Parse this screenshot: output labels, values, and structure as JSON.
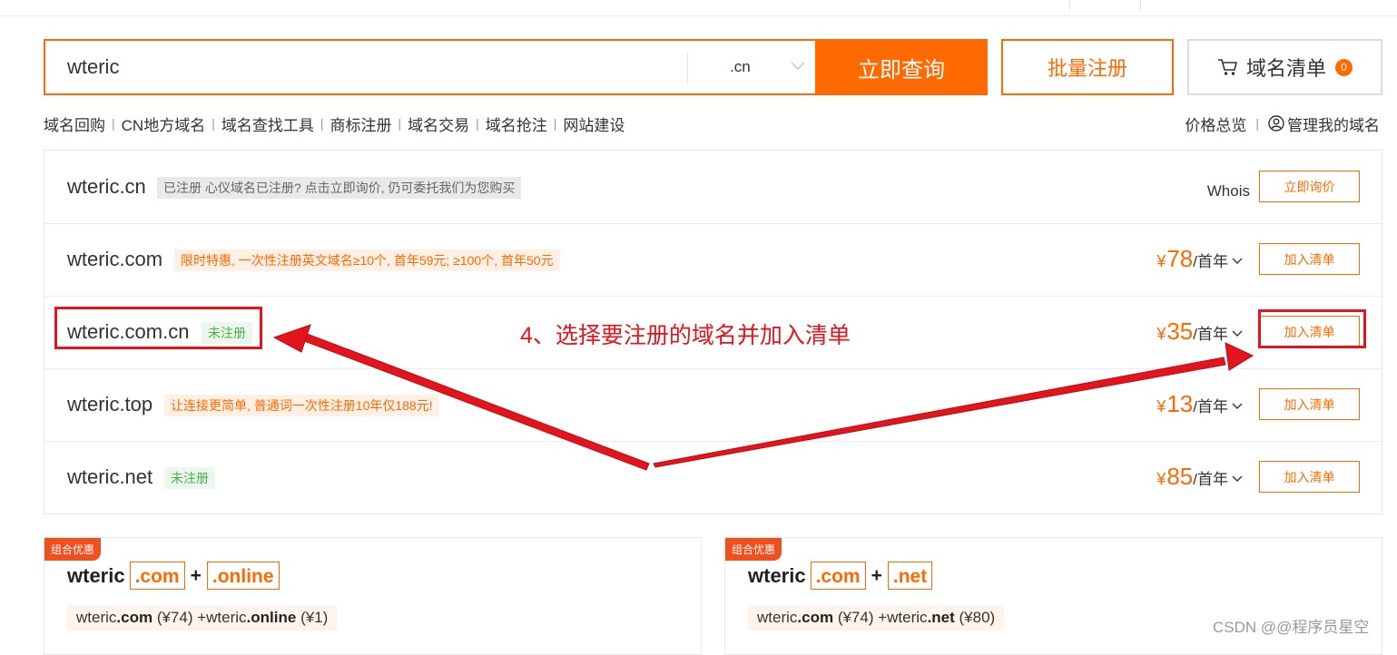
{
  "search": {
    "value": "wteric",
    "tld": ".cn",
    "submit_label": "立即查询",
    "bulk_label": "批量注册",
    "cart_label": "域名清单",
    "cart_count": "0"
  },
  "subnav": {
    "left": [
      "域名回购",
      "CN地方域名",
      "域名查找工具",
      "商标注册",
      "域名交易",
      "域名抢注",
      "网站建设"
    ],
    "separator": "|",
    "price_overview": "价格总览",
    "manage": "管理我的域名"
  },
  "results": [
    {
      "domain": "wteric.cn",
      "tag": "已注册 心仪域名已注册? 点击立即询价, 仍可委托我们为您购买",
      "tag_type": "registered",
      "whois": "Whois",
      "action": "立即询价"
    },
    {
      "domain": "wteric.com",
      "tag": "限时特惠, 一次性注册英文域名≥10个, 首年59元; ≥100个, 首年50元",
      "tag_type": "promo",
      "currency": "¥",
      "price": "78",
      "unit": "/首年",
      "action": "加入清单"
    },
    {
      "domain": "wteric.com.cn",
      "tag": "未注册",
      "tag_type": "free",
      "currency": "¥",
      "price": "35",
      "unit": "/首年",
      "action": "加入清单"
    },
    {
      "domain": "wteric.top",
      "tag": "让连接更简单, 普通词一次性注册10年仅188元!",
      "tag_type": "promo",
      "currency": "¥",
      "price": "13",
      "unit": "/首年",
      "action": "加入清单"
    },
    {
      "domain": "wteric.net",
      "tag": "未注册",
      "tag_type": "free",
      "currency": "¥",
      "price": "85",
      "unit": "/首年",
      "action": "加入清单"
    }
  ],
  "combos": [
    {
      "badge": "组合优惠",
      "name": "wteric",
      "tld1": ".com",
      "plus": "+",
      "tld2": ".online",
      "detail_a": "wteric",
      "detail_a_tld": ".com",
      "detail_a_price": " (¥74) +",
      "detail_b": "wteric",
      "detail_b_tld": ".online",
      "detail_b_price": " (¥1)"
    },
    {
      "badge": "组合优惠",
      "name": "wteric",
      "tld1": ".com",
      "plus": "+",
      "tld2": ".net",
      "detail_a": "wteric",
      "detail_a_tld": ".com",
      "detail_a_price": " (¥74) +",
      "detail_b": "wteric",
      "detail_b_tld": ".net",
      "detail_b_price": " (¥80)"
    }
  ],
  "annotation": {
    "text": "4、选择要注册的域名并加入清单",
    "color": "#e3141c"
  },
  "watermark": "CSDN @@程序员星空",
  "colors": {
    "accent": "#ff6a00",
    "annotation": "#e3141c",
    "free_tag": "#4cae4c"
  }
}
